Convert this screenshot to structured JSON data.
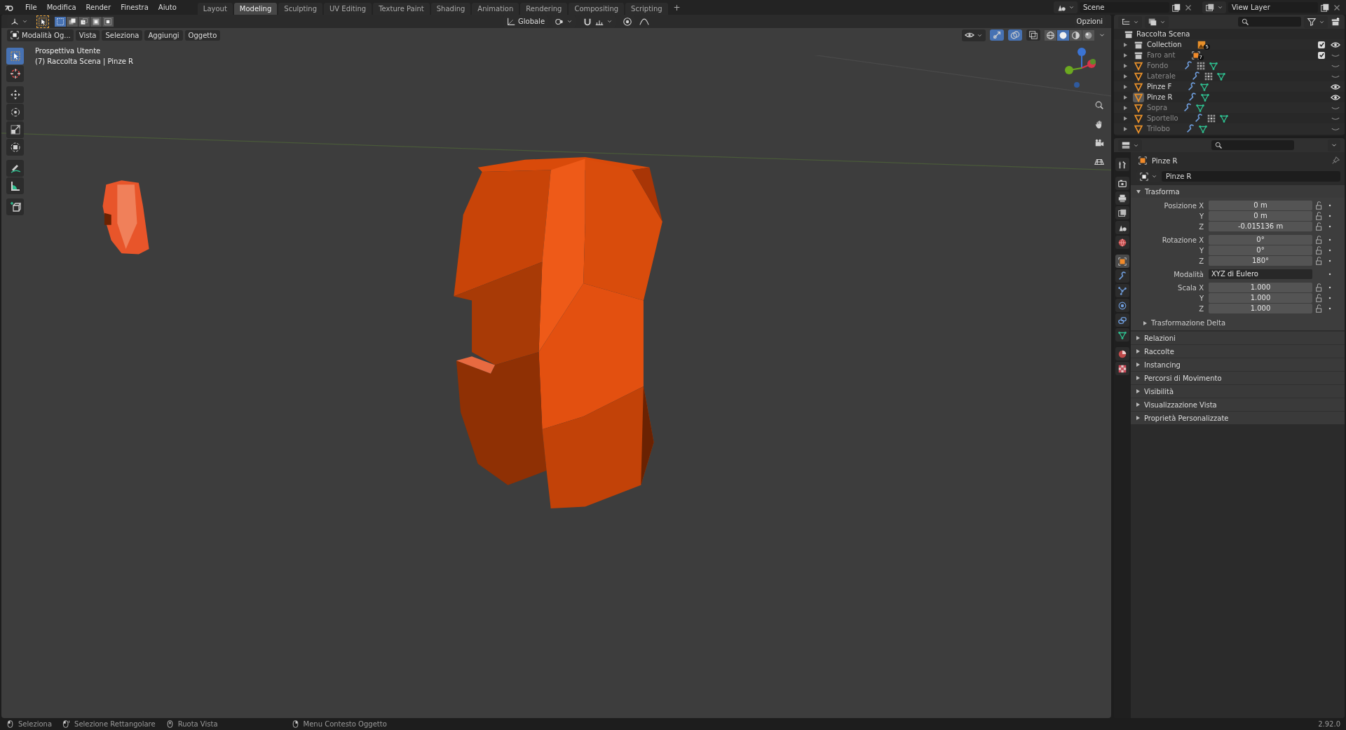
{
  "menubar": {
    "items": [
      "File",
      "Modifica",
      "Render",
      "Finestra",
      "Aiuto"
    ]
  },
  "workspaces": [
    {
      "label": "Layout",
      "selected": false
    },
    {
      "label": "Modeling",
      "selected": true
    },
    {
      "label": "Sculpting",
      "selected": false
    },
    {
      "label": "UV Editing",
      "selected": false
    },
    {
      "label": "Texture Paint",
      "selected": false
    },
    {
      "label": "Shading",
      "selected": false
    },
    {
      "label": "Animation",
      "selected": false
    },
    {
      "label": "Rendering",
      "selected": false
    },
    {
      "label": "Compositing",
      "selected": false
    },
    {
      "label": "Scripting",
      "selected": false
    }
  ],
  "add_workspace": "+",
  "scene": {
    "name": "Scene"
  },
  "view_layer": {
    "name": "View Layer"
  },
  "viewport": {
    "select_modes": [
      {
        "kind": "set",
        "selected": true
      },
      {
        "kind": "extend",
        "selected": false
      },
      {
        "kind": "subtract",
        "selected": false
      },
      {
        "kind": "invert",
        "selected": false
      },
      {
        "kind": "intersect",
        "selected": false
      }
    ],
    "orientation": "Globale",
    "options": "Opzioni",
    "mode": "Modalità Og...",
    "menus": [
      "Vista",
      "Seleziona",
      "Aggiungi",
      "Oggetto"
    ],
    "toggles": [
      {
        "kind": "gizmo",
        "on": true
      },
      {
        "kind": "overlay",
        "on": true
      },
      {
        "kind": "xray",
        "on": false
      }
    ],
    "shading_modes": [
      {
        "kind": "wireframe",
        "selected": false
      },
      {
        "kind": "solid",
        "selected": true
      },
      {
        "kind": "material",
        "selected": false
      },
      {
        "kind": "rendered",
        "selected": false
      }
    ],
    "tool_groups": [
      [
        {
          "kind": "select",
          "selected": true
        },
        {
          "kind": "cursor",
          "selected": false
        }
      ],
      [
        {
          "kind": "move",
          "selected": false
        },
        {
          "kind": "rotate",
          "selected": false
        },
        {
          "kind": "scale",
          "selected": false
        },
        {
          "kind": "transform",
          "selected": false
        }
      ],
      [
        {
          "kind": "annotate",
          "selected": false
        },
        {
          "kind": "measure",
          "selected": false
        }
      ],
      [
        {
          "kind": "add_cube",
          "selected": false
        }
      ]
    ],
    "view_name": "Prospettiva Utente",
    "context": "(7) Raccolta Scena | Pinze R"
  },
  "outliner": {
    "root": "Raccolta Scena",
    "rows": [
      {
        "name": "Collection",
        "kind": "collection",
        "expanded": false,
        "selected": false,
        "visible": true,
        "checked": true,
        "extras": [
          {
            "kind": "image",
            "count": "5"
          }
        ]
      },
      {
        "name": "Faro ant",
        "kind": "collection",
        "expanded": false,
        "selected": false,
        "visible": false,
        "checked": true,
        "extras": [
          {
            "kind": "object",
            "count": "7"
          }
        ]
      },
      {
        "name": "Fondo",
        "kind": "mesh",
        "expanded": false,
        "selected": false,
        "visible": false,
        "extras": [
          {
            "kind": "modifier"
          },
          {
            "kind": "array"
          },
          {
            "kind": "mesh_data"
          }
        ]
      },
      {
        "name": "Laterale",
        "kind": "mesh",
        "expanded": false,
        "selected": false,
        "visible": false,
        "extras": [
          {
            "kind": "modifier"
          },
          {
            "kind": "array"
          },
          {
            "kind": "mesh_data"
          }
        ]
      },
      {
        "name": "Pinze F",
        "kind": "mesh",
        "expanded": false,
        "selected": false,
        "visible": true,
        "extras": [
          {
            "kind": "modifier"
          },
          {
            "kind": "mesh_data"
          }
        ]
      },
      {
        "name": "Pinze R",
        "kind": "mesh",
        "expanded": false,
        "selected": true,
        "visible": true,
        "extras": [
          {
            "kind": "modifier"
          },
          {
            "kind": "mesh_data"
          }
        ]
      },
      {
        "name": "Sopra",
        "kind": "mesh",
        "expanded": false,
        "selected": false,
        "visible": false,
        "extras": [
          {
            "kind": "modifier"
          },
          {
            "kind": "mesh_data"
          }
        ]
      },
      {
        "name": "Sportello",
        "kind": "mesh",
        "expanded": false,
        "selected": false,
        "visible": false,
        "extras": [
          {
            "kind": "modifier"
          },
          {
            "kind": "array"
          },
          {
            "kind": "mesh_data"
          }
        ]
      },
      {
        "name": "Trilobo",
        "kind": "mesh",
        "expanded": false,
        "selected": false,
        "visible": false,
        "extras": [
          {
            "kind": "modifier"
          },
          {
            "kind": "mesh_data"
          }
        ]
      }
    ]
  },
  "properties": {
    "tabs": [
      {
        "kind": "tool",
        "selected": false
      },
      {
        "kind": "render",
        "selected": false
      },
      {
        "kind": "output",
        "selected": false
      },
      {
        "kind": "view_layer",
        "selected": false
      },
      {
        "kind": "scene",
        "selected": false
      },
      {
        "kind": "world",
        "selected": false
      },
      {
        "kind": "object",
        "selected": true
      },
      {
        "kind": "modifiers",
        "selected": false
      },
      {
        "kind": "particles",
        "selected": false
      },
      {
        "kind": "physics",
        "selected": false
      },
      {
        "kind": "constraints",
        "selected": false
      },
      {
        "kind": "data",
        "selected": false
      },
      {
        "kind": "material",
        "selected": false
      },
      {
        "kind": "texture",
        "selected": false
      }
    ],
    "object_name": "Pinze R",
    "data_name": "Pinze R",
    "panel": {
      "title": "Trasforma",
      "expanded": true,
      "groups": [
        {
          "kind": "fields",
          "rows": [
            {
              "label": "Posizione X",
              "value": "0 m"
            },
            {
              "label": "Y",
              "value": "0 m"
            },
            {
              "label": "Z",
              "value": "-0.015136 m"
            }
          ]
        },
        {
          "kind": "fields",
          "rows": [
            {
              "label": "Rotazione X",
              "value": "0°"
            },
            {
              "label": "Y",
              "value": "0°"
            },
            {
              "label": "Z",
              "value": "180°"
            }
          ]
        },
        {
          "kind": "dropdown",
          "label": "Modalità",
          "value": "XYZ di Eulero"
        },
        {
          "kind": "fields",
          "rows": [
            {
              "label": "Scala X",
              "value": "1.000"
            },
            {
              "label": "Y",
              "value": "1.000"
            },
            {
              "label": "Z",
              "value": "1.000"
            }
          ]
        }
      ],
      "subpanel": {
        "title": "Trasformazione Delta",
        "expanded": false
      }
    },
    "panels": [
      {
        "title": "Relazioni",
        "expanded": false
      },
      {
        "title": "Raccolte",
        "expanded": false
      },
      {
        "title": "Instancing",
        "expanded": false
      },
      {
        "title": "Percorsi di Movimento",
        "expanded": false
      },
      {
        "title": "Visibilità",
        "expanded": false
      },
      {
        "title": "Visualizzazione Vista",
        "expanded": false
      },
      {
        "title": "Proprietà Personalizzate",
        "expanded": false
      }
    ]
  },
  "status_bar": {
    "hints": [
      {
        "kind": "left",
        "label": "Seleziona"
      },
      {
        "kind": "drag",
        "label": "Selezione Rettangolare"
      },
      {
        "kind": "middle",
        "label": "Ruota Vista"
      },
      {
        "kind": "right",
        "label": "Menu Contesto Oggetto"
      }
    ],
    "version": "2.92.0"
  }
}
